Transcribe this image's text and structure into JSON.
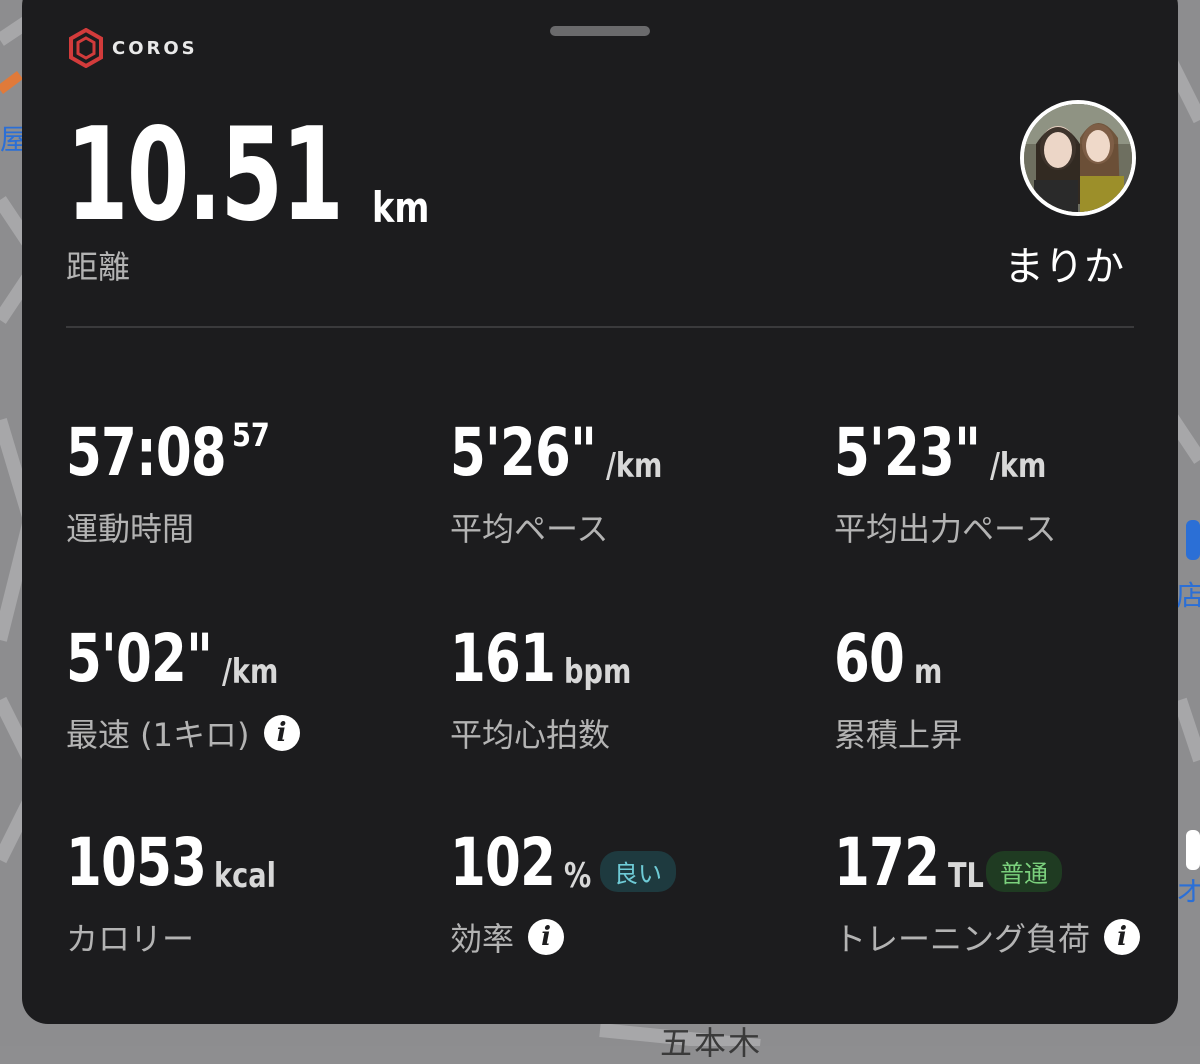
{
  "app": {
    "logo_text": "COROS"
  },
  "map": {
    "left_label": "屋",
    "right_label_top": "店",
    "right_label_bottom": "オ",
    "bottom_label": "五本木"
  },
  "distance": {
    "value": "10.51",
    "unit": "km",
    "label": "距離"
  },
  "user": {
    "name": "まりか"
  },
  "stats": {
    "moving_time": {
      "value": "57:08",
      "sup": "57",
      "label": "運動時間"
    },
    "avg_pace": {
      "value": "5'26\"",
      "unit": "/km",
      "label": "平均ペース"
    },
    "avg_power_pace": {
      "value": "5'23\"",
      "unit": "/km",
      "label": "平均出力ペース"
    },
    "best_km": {
      "value": "5'02\"",
      "unit": "/km",
      "label": "最速 (1キロ)"
    },
    "avg_hr": {
      "value": "161",
      "unit": "bpm",
      "label": "平均心拍数"
    },
    "elevation_gain": {
      "value": "60",
      "unit": "m",
      "label": "累積上昇"
    },
    "calories": {
      "value": "1053",
      "unit": "kcal",
      "label": "カロリー"
    },
    "efficiency": {
      "value": "102",
      "unit": "%",
      "badge": "良い",
      "label": "効率"
    },
    "training_load": {
      "value": "172",
      "unit": "TL",
      "badge": "普通",
      "label": "トレーニング負荷"
    }
  },
  "colors": {
    "card_bg": "#1c1c1e",
    "badge_good": "#6ecbd6",
    "badge_normal": "#7bd17d",
    "logo_red": "#d23b3b"
  },
  "icons": [
    "coros-logo-icon",
    "info-icon"
  ]
}
